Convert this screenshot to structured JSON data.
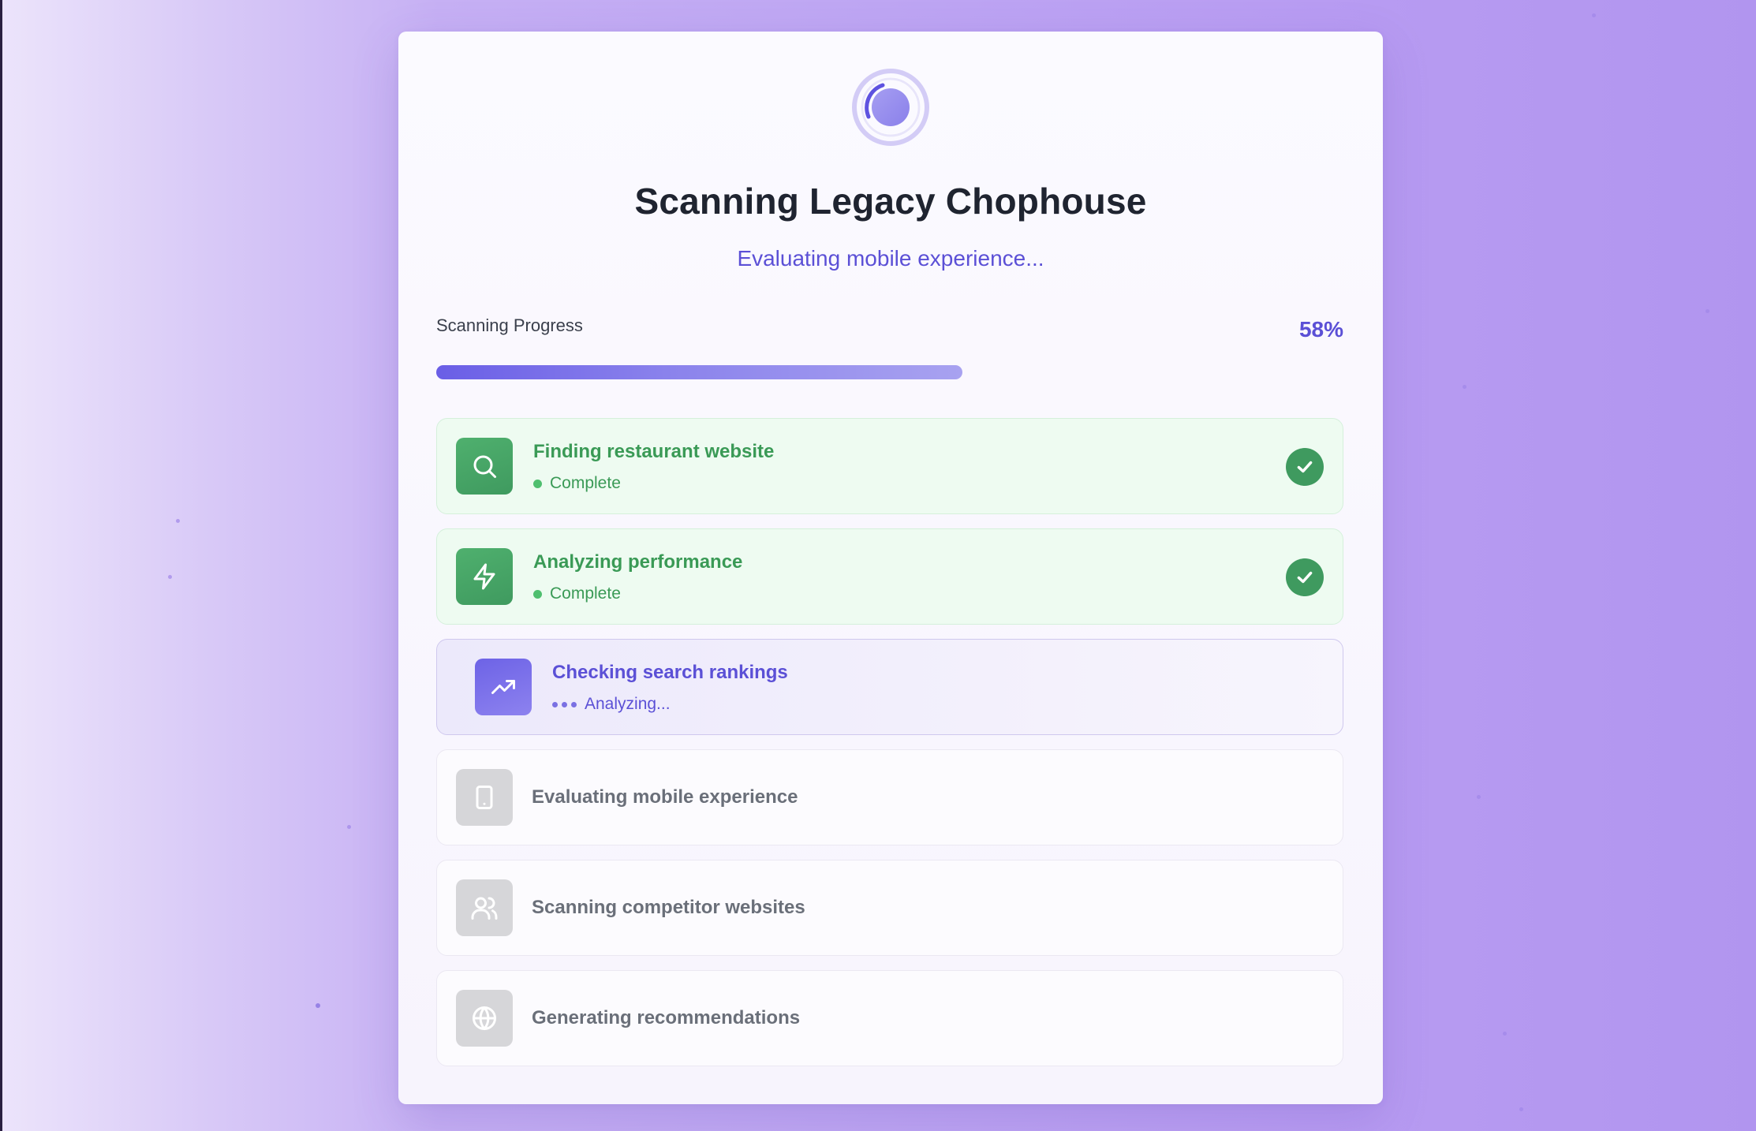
{
  "scan": {
    "title": "Scanning Legacy Chophouse",
    "current_task": "Evaluating mobile experience...",
    "progress_label": "Scanning Progress",
    "progress_text": "58%",
    "progress_fraction": 0.58
  },
  "steps": [
    {
      "title": "Finding restaurant website",
      "status": "Complete",
      "state": "done",
      "icon": "search-icon"
    },
    {
      "title": "Analyzing performance",
      "status": "Complete",
      "state": "done",
      "icon": "lightning-icon"
    },
    {
      "title": "Checking search rankings",
      "status": "Analyzing...",
      "state": "active",
      "icon": "trending-up-icon"
    },
    {
      "title": "Evaluating mobile experience",
      "status": "",
      "state": "pending",
      "icon": "tablet-icon"
    },
    {
      "title": "Scanning competitor websites",
      "status": "",
      "state": "pending",
      "icon": "users-icon"
    },
    {
      "title": "Generating recommendations",
      "status": "",
      "state": "pending",
      "icon": "globe-icon"
    }
  ],
  "colors": {
    "accent": "#5b50d6",
    "success": "#3f9a5f",
    "pending": "#d6d6d9"
  }
}
